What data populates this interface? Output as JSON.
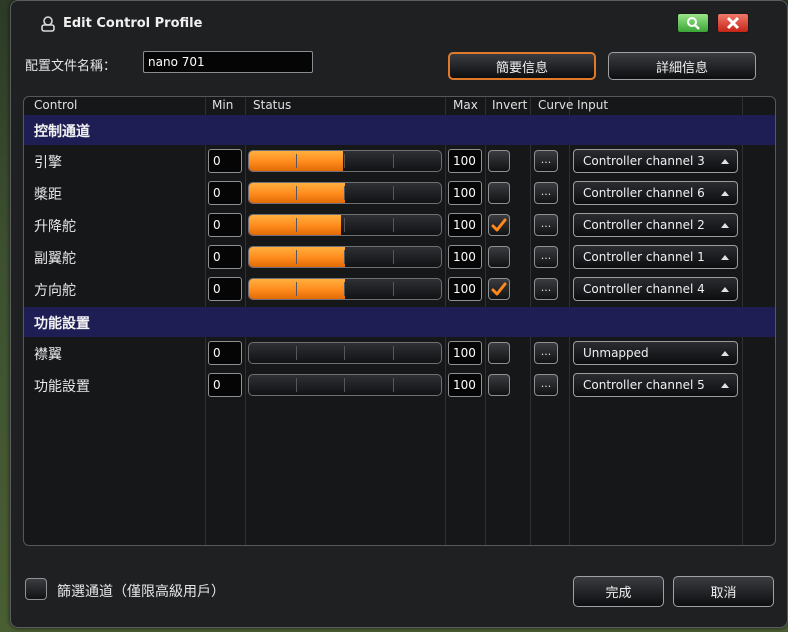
{
  "window": {
    "title": "Edit Control Profile"
  },
  "profile": {
    "name_label": "配置文件名稱：",
    "name_value": "nano 701"
  },
  "tabs": {
    "summary": "簡要信息",
    "detail": "詳細信息"
  },
  "headers": {
    "control": "Control",
    "min": "Min",
    "status": "Status",
    "max": "Max",
    "invert": "Invert",
    "curve": "Curve",
    "input": "Input"
  },
  "sections": [
    {
      "label": "控制通道",
      "rows": [
        {
          "name": "引擎",
          "min": "0",
          "max": "100",
          "invert": false,
          "input": "Controller channel 3",
          "level": 0.49
        },
        {
          "name": "槳距",
          "min": "0",
          "max": "100",
          "invert": false,
          "input": "Controller channel 6",
          "level": 0.5
        },
        {
          "name": "升降舵",
          "min": "0",
          "max": "100",
          "invert": true,
          "input": "Controller channel 2",
          "level": 0.48
        },
        {
          "name": "副翼舵",
          "min": "0",
          "max": "100",
          "invert": false,
          "input": "Controller channel 1",
          "level": 0.5
        },
        {
          "name": "方向舵",
          "min": "0",
          "max": "100",
          "invert": true,
          "input": "Controller channel 4",
          "level": 0.5
        }
      ]
    },
    {
      "label": "功能設置",
      "rows": [
        {
          "name": "襟翼",
          "min": "0",
          "max": "100",
          "invert": false,
          "input": "Unmapped",
          "level": 0
        },
        {
          "name": "功能設置",
          "min": "0",
          "max": "100",
          "invert": false,
          "input": "Controller channel 5",
          "level": 0
        }
      ]
    }
  ],
  "curve_label": "...",
  "footer": {
    "filter_label": "篩選通道（僅限高級用戶）",
    "done": "完成",
    "cancel": "取消"
  },
  "colors": {
    "accent": "#ff8a1a",
    "section_bg": "#1e1e55",
    "check": "#ff8a1a"
  },
  "icons": {
    "title": "controller-profile-icon",
    "search": "search-icon",
    "close": "close-icon",
    "check": "checkmark-icon",
    "select": "chevron-up-icon"
  }
}
